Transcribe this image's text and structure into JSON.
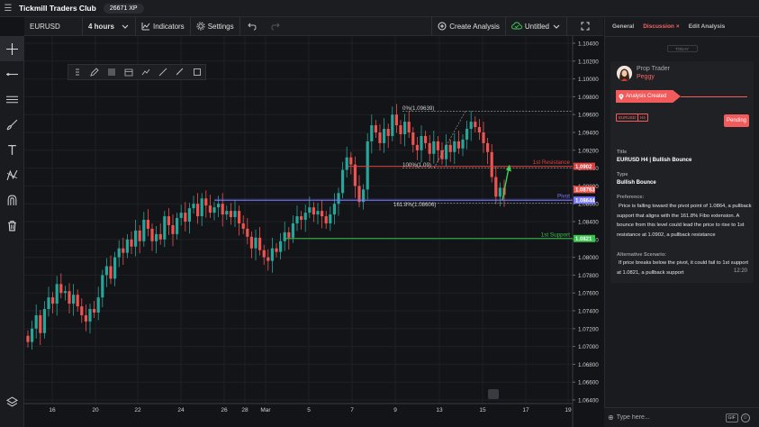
{
  "app": {
    "title": "Tickmill Traders Club",
    "xp": "26671 XP"
  },
  "toolbar": {
    "symbol": "EURUSD",
    "interval": "4 hours",
    "indicators": "Indicators",
    "settings": "Settings",
    "create_analysis": "Create Analysis",
    "save_state": "Untitled"
  },
  "left_tools": [
    "crosshair-icon",
    "horizontal-line-icon",
    "parallel-channel-icon",
    "brush-icon",
    "text-icon",
    "pattern-icon",
    "magnet-icon",
    "trash-icon",
    "layers-icon"
  ],
  "draw_tools": [
    "drag-handle-icon",
    "pencil-icon",
    "fib-icon",
    "template-icon",
    "path-icon",
    "trendline-icon",
    "ruler-icon",
    "rectangle-icon"
  ],
  "chart_data": {
    "type": "candlestick",
    "symbol": "EURUSD",
    "interval": "4 hours",
    "ylim": [
      1.063,
      1.1045
    ],
    "y_ticks": [
      "1.10400",
      "1.10200",
      "1.10000",
      "1.09800",
      "1.09600",
      "1.09400",
      "1.09200",
      "1.09000",
      "1.08800",
      "1.08600",
      "1.08400",
      "1.08200",
      "1.08000",
      "1.07800",
      "1.07600",
      "1.07400",
      "1.07200",
      "1.07000",
      "1.06800",
      "1.06600",
      "1.06400"
    ],
    "x_ticks": [
      "16",
      "20",
      "22",
      "24",
      "26",
      "28",
      "Mar",
      "5",
      "7",
      "9",
      "13",
      "15",
      "17",
      "19"
    ],
    "levels": [
      {
        "name": "1st Resistance",
        "value": 1.0902,
        "price_label": "1.0902",
        "color": "#e0403f"
      },
      {
        "name": "Pivot",
        "value": 1.0864,
        "price_label": "1.08644",
        "color": "#7a78ff"
      },
      {
        "name": "1st Support",
        "value": 1.0821,
        "price_label": "1.0821",
        "color": "#37c24a"
      }
    ],
    "current_price": {
      "value": 1.0876,
      "label": "1.08763"
    },
    "fib_labels": [
      {
        "text": "0%(1.09639)",
        "value": 1.09639
      },
      {
        "text": "100%(1.09)",
        "value": 1.09
      },
      {
        "text": "161.8%(1.08606)",
        "value": 1.08606
      }
    ]
  },
  "panel": {
    "tabs": [
      "General",
      "Discussion",
      "Edit Analysis"
    ],
    "tab_close": "×",
    "today": "TODAY",
    "author_role": "Prop Trader",
    "author_name": "Peggy",
    "status": "Analysis Created",
    "tag_symbol": "EURUSD",
    "tag_tf": "H4",
    "pending": "Pending",
    "title_label": "Title",
    "title_value": "EURUSD H4 | Bullish Bounce",
    "type_label": "Type",
    "type_value": "Bullish Bounce",
    "preference_label": "Preference:",
    "preference_text": "Price is falling toward the pivot point of 1.0864, a pullback support that aligns with the 161.8% Fibo extension. A bounce from this level could lead the price to rise to 1st resistance at 1.0902, a pullback resistance",
    "alt_label": "Alternative Scenario:",
    "alt_text": "If price breaks below the pivot, it could fail to 1st support at 1.0821, a pullback support",
    "timestamp": "12:20"
  },
  "comment": {
    "placeholder": "Type here...",
    "gif": "GIF"
  },
  "colors": {
    "accent": "#f25b5b",
    "bull": "#26a69a",
    "bear": "#ef5350"
  }
}
